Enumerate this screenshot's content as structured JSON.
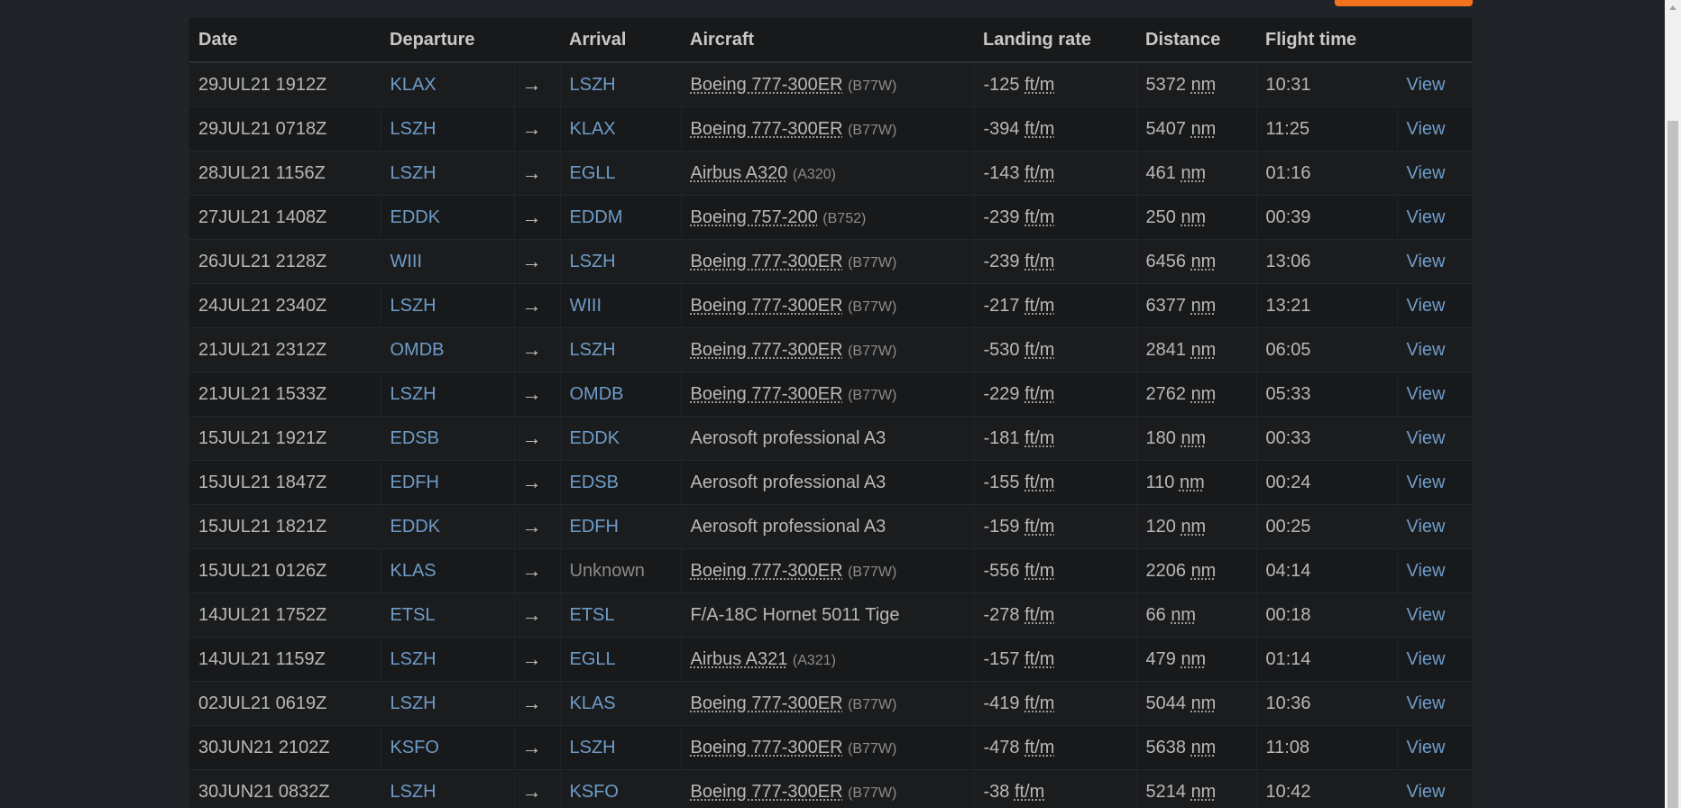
{
  "table": {
    "headers": [
      "Date",
      "Departure",
      "",
      "Arrival",
      "Aircraft",
      "Landing rate",
      "Distance",
      "Flight time",
      ""
    ],
    "rows": [
      {
        "date": "29JUL21 1912Z",
        "dep": "KLAX",
        "arr": "LSZH",
        "arr_known": true,
        "aircraft": "Boeing 777-300ER",
        "ac_abbr": true,
        "ac_code": "(B77W)",
        "rate": "-125",
        "rate_unit": "ft/m",
        "dist": "5372",
        "dist_unit": "nm",
        "time": "10:31",
        "view": "View"
      },
      {
        "date": "29JUL21 0718Z",
        "dep": "LSZH",
        "arr": "KLAX",
        "arr_known": true,
        "aircraft": "Boeing 777-300ER",
        "ac_abbr": true,
        "ac_code": "(B77W)",
        "rate": "-394",
        "rate_unit": "ft/m",
        "dist": "5407",
        "dist_unit": "nm",
        "time": "11:25",
        "view": "View"
      },
      {
        "date": "28JUL21 1156Z",
        "dep": "LSZH",
        "arr": "EGLL",
        "arr_known": true,
        "aircraft": "Airbus A320",
        "ac_abbr": true,
        "ac_code": "(A320)",
        "rate": "-143",
        "rate_unit": "ft/m",
        "dist": "461",
        "dist_unit": "nm",
        "time": "01:16",
        "view": "View"
      },
      {
        "date": "27JUL21 1408Z",
        "dep": "EDDK",
        "arr": "EDDM",
        "arr_known": true,
        "aircraft": "Boeing 757-200",
        "ac_abbr": true,
        "ac_code": "(B752)",
        "rate": "-239",
        "rate_unit": "ft/m",
        "dist": "250",
        "dist_unit": "nm",
        "time": "00:39",
        "view": "View"
      },
      {
        "date": "26JUL21 2128Z",
        "dep": "WIII",
        "arr": "LSZH",
        "arr_known": true,
        "aircraft": "Boeing 777-300ER",
        "ac_abbr": true,
        "ac_code": "(B77W)",
        "rate": "-239",
        "rate_unit": "ft/m",
        "dist": "6456",
        "dist_unit": "nm",
        "time": "13:06",
        "view": "View"
      },
      {
        "date": "24JUL21 2340Z",
        "dep": "LSZH",
        "arr": "WIII",
        "arr_known": true,
        "aircraft": "Boeing 777-300ER",
        "ac_abbr": true,
        "ac_code": "(B77W)",
        "rate": "-217",
        "rate_unit": "ft/m",
        "dist": "6377",
        "dist_unit": "nm",
        "time": "13:21",
        "view": "View"
      },
      {
        "date": "21JUL21 2312Z",
        "dep": "OMDB",
        "arr": "LSZH",
        "arr_known": true,
        "aircraft": "Boeing 777-300ER",
        "ac_abbr": true,
        "ac_code": "(B77W)",
        "rate": "-530",
        "rate_unit": "ft/m",
        "dist": "2841",
        "dist_unit": "nm",
        "time": "06:05",
        "view": "View"
      },
      {
        "date": "21JUL21 1533Z",
        "dep": "LSZH",
        "arr": "OMDB",
        "arr_known": true,
        "aircraft": "Boeing 777-300ER",
        "ac_abbr": true,
        "ac_code": "(B77W)",
        "rate": "-229",
        "rate_unit": "ft/m",
        "dist": "2762",
        "dist_unit": "nm",
        "time": "05:33",
        "view": "View"
      },
      {
        "date": "15JUL21 1921Z",
        "dep": "EDSB",
        "arr": "EDDK",
        "arr_known": true,
        "aircraft": "Aerosoft professional A3",
        "ac_abbr": false,
        "ac_code": "",
        "rate": "-181",
        "rate_unit": "ft/m",
        "dist": "180",
        "dist_unit": "nm",
        "time": "00:33",
        "view": "View"
      },
      {
        "date": "15JUL21 1847Z",
        "dep": "EDFH",
        "arr": "EDSB",
        "arr_known": true,
        "aircraft": "Aerosoft professional A3",
        "ac_abbr": false,
        "ac_code": "",
        "rate": "-155",
        "rate_unit": "ft/m",
        "dist": "110",
        "dist_unit": "nm",
        "time": "00:24",
        "view": "View"
      },
      {
        "date": "15JUL21 1821Z",
        "dep": "EDDK",
        "arr": "EDFH",
        "arr_known": true,
        "aircraft": "Aerosoft professional A3",
        "ac_abbr": false,
        "ac_code": "",
        "rate": "-159",
        "rate_unit": "ft/m",
        "dist": "120",
        "dist_unit": "nm",
        "time": "00:25",
        "view": "View"
      },
      {
        "date": "15JUL21 0126Z",
        "dep": "KLAS",
        "arr": "Unknown",
        "arr_known": false,
        "aircraft": "Boeing 777-300ER",
        "ac_abbr": true,
        "ac_code": "(B77W)",
        "rate": "-556",
        "rate_unit": "ft/m",
        "dist": "2206",
        "dist_unit": "nm",
        "time": "04:14",
        "view": "View"
      },
      {
        "date": "14JUL21 1752Z",
        "dep": "ETSL",
        "arr": "ETSL",
        "arr_known": true,
        "aircraft": "F/A-18C Hornet 5011 Tige",
        "ac_abbr": false,
        "ac_code": "",
        "rate": "-278",
        "rate_unit": "ft/m",
        "dist": "66",
        "dist_unit": "nm",
        "time": "00:18",
        "view": "View"
      },
      {
        "date": "14JUL21 1159Z",
        "dep": "LSZH",
        "arr": "EGLL",
        "arr_known": true,
        "aircraft": "Airbus A321",
        "ac_abbr": true,
        "ac_code": "(A321)",
        "rate": "-157",
        "rate_unit": "ft/m",
        "dist": "479",
        "dist_unit": "nm",
        "time": "01:14",
        "view": "View"
      },
      {
        "date": "02JUL21 0619Z",
        "dep": "LSZH",
        "arr": "KLAS",
        "arr_known": true,
        "aircraft": "Boeing 777-300ER",
        "ac_abbr": true,
        "ac_code": "(B77W)",
        "rate": "-419",
        "rate_unit": "ft/m",
        "dist": "5044",
        "dist_unit": "nm",
        "time": "10:36",
        "view": "View"
      },
      {
        "date": "30JUN21 2102Z",
        "dep": "KSFO",
        "arr": "LSZH",
        "arr_known": true,
        "aircraft": "Boeing 777-300ER",
        "ac_abbr": true,
        "ac_code": "(B77W)",
        "rate": "-478",
        "rate_unit": "ft/m",
        "dist": "5638",
        "dist_unit": "nm",
        "time": "11:08",
        "view": "View"
      },
      {
        "date": "30JUN21 0832Z",
        "dep": "LSZH",
        "arr": "KSFO",
        "arr_known": true,
        "aircraft": "Boeing 777-300ER",
        "ac_abbr": true,
        "ac_code": "(B77W)",
        "rate": "-38",
        "rate_unit": "ft/m",
        "dist": "5214",
        "dist_unit": "nm",
        "time": "10:42",
        "view": "View"
      }
    ]
  },
  "icons": {
    "route_arrow": "→"
  },
  "colors": {
    "accent": "#f5731e",
    "link": "#6f9cc8",
    "background": "#202429",
    "table_bg": "#17191b"
  }
}
